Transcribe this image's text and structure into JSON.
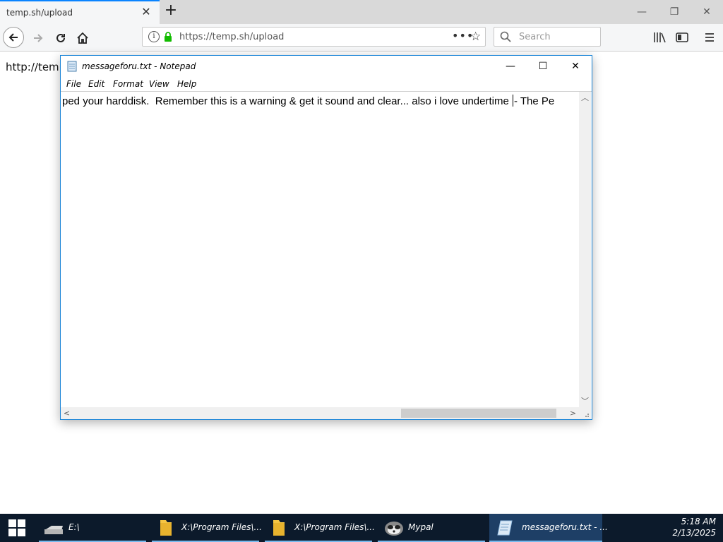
{
  "browser": {
    "tab_title": "temp.sh/upload",
    "url": "https://temp.sh/upload",
    "search_placeholder": "Search",
    "page_text": "http://temp"
  },
  "notepad": {
    "title": "messageforu.txt - Notepad",
    "menu": [
      "File",
      "Edit",
      "Format",
      "View",
      "Help"
    ],
    "content_before_caret": "ped your harddisk.  Remember this is a warning & get it sound and clear... also i love undertime ",
    "content_after_caret": "- The Pe"
  },
  "taskbar": {
    "items": [
      {
        "label": "E:\\",
        "icon": "drive-icon"
      },
      {
        "label": "X:\\Program Files\\...",
        "icon": "folder-icon"
      },
      {
        "label": "X:\\Program Files\\...",
        "icon": "folder-icon"
      },
      {
        "label": "Mypal",
        "icon": "mypal-icon"
      },
      {
        "label": "messageforu.txt - ...",
        "icon": "notepad-icon"
      }
    ],
    "time": "5:18 AM",
    "date": "2/13/2025"
  },
  "colors": {
    "accent": "#0a84ff",
    "window_border": "#1883d7",
    "taskbar": "#0c1a2b",
    "lock_green": "#12bc00"
  }
}
